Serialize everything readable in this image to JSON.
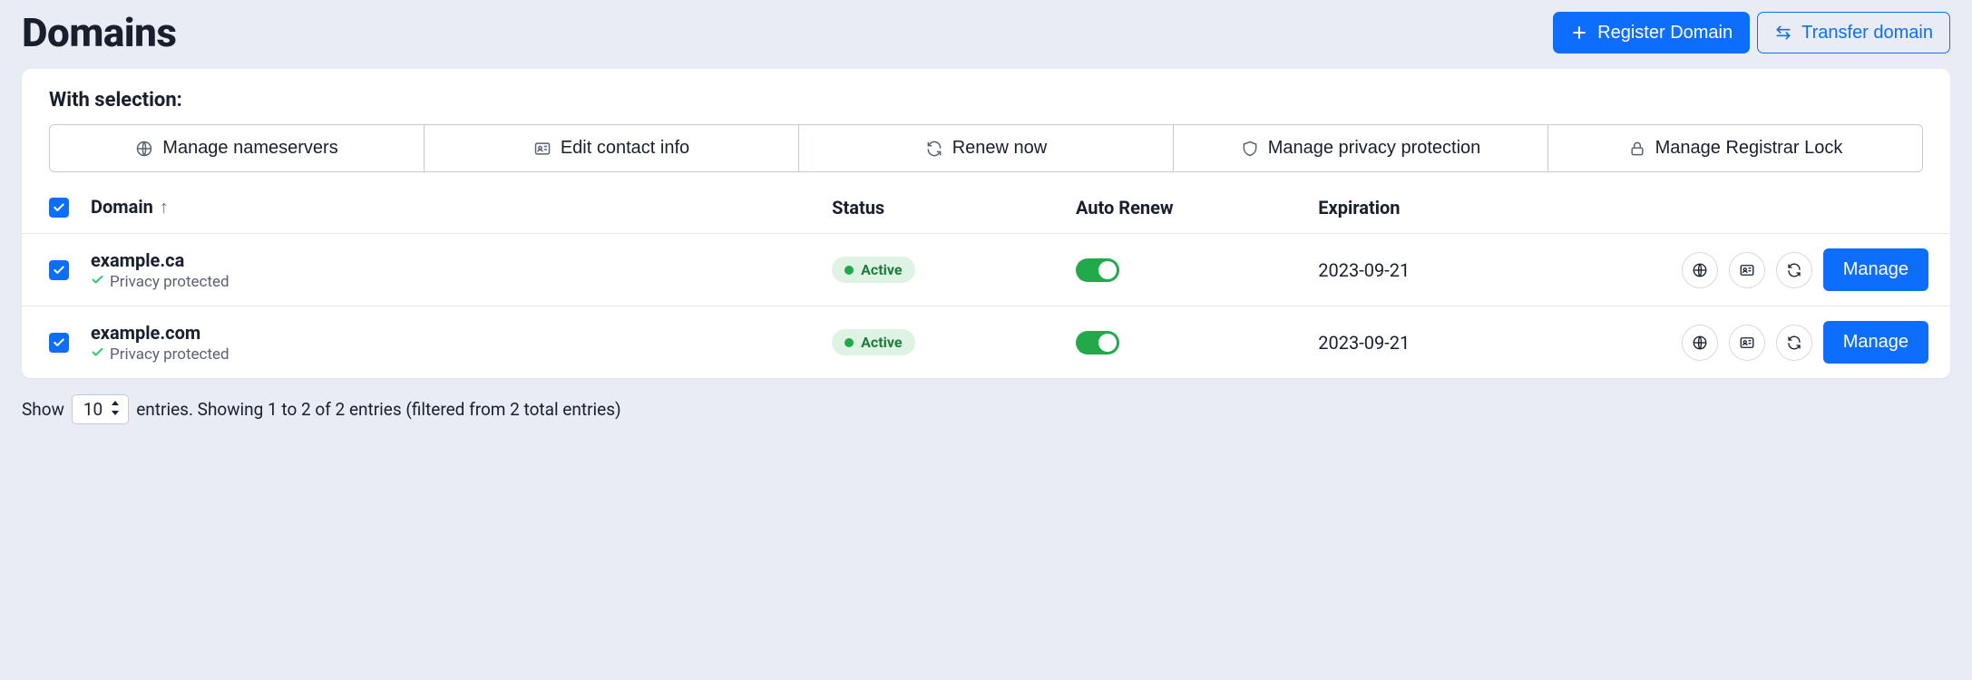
{
  "header": {
    "title": "Domains",
    "register_label": "Register Domain",
    "transfer_label": "Transfer domain"
  },
  "selection": {
    "label": "With selection:",
    "actions": {
      "nameservers": "Manage nameservers",
      "contact": "Edit contact info",
      "renew": "Renew now",
      "privacy": "Manage privacy protection",
      "lock": "Manage Registrar Lock"
    }
  },
  "table": {
    "headers": {
      "domain": "Domain",
      "status": "Status",
      "auto_renew": "Auto Renew",
      "expiration": "Expiration"
    },
    "rows": [
      {
        "domain": "example.ca",
        "privacy_label": "Privacy protected",
        "status_label": "Active",
        "expiration": "2023-09-21",
        "manage_label": "Manage"
      },
      {
        "domain": "example.com",
        "privacy_label": "Privacy protected",
        "status_label": "Active",
        "expiration": "2023-09-21",
        "manage_label": "Manage"
      }
    ]
  },
  "footer": {
    "show_label": "Show",
    "page_size": "10",
    "entries_text": "entries. Showing 1 to 2 of 2 entries (filtered from 2 total entries)"
  }
}
